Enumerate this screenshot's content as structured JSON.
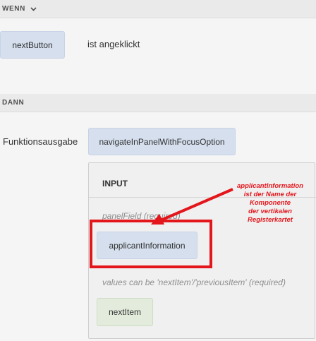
{
  "when_section": {
    "header": "WENN",
    "chevron_icon": "chevron-down-icon",
    "component_button": "nextButton",
    "event_text": "ist angeklickt"
  },
  "then_section": {
    "header": "DANN",
    "function_label": "Funktionsausgabe",
    "function_button": "navigateInPanelWithFocusOption",
    "input_panel": {
      "title": "INPUT",
      "panel_field_hint": "panelField (required)",
      "panel_field_value": "applicantInformation",
      "values_hint": "values can be 'nextItem'/'previousItem' (required)",
      "values_value": "nextItem"
    }
  },
  "annotation": {
    "lines": [
      "applicantInformation",
      "ist der Name der",
      "Komponente",
      "der vertikalen",
      "Registerkartet"
    ],
    "color": "#e3161c"
  }
}
